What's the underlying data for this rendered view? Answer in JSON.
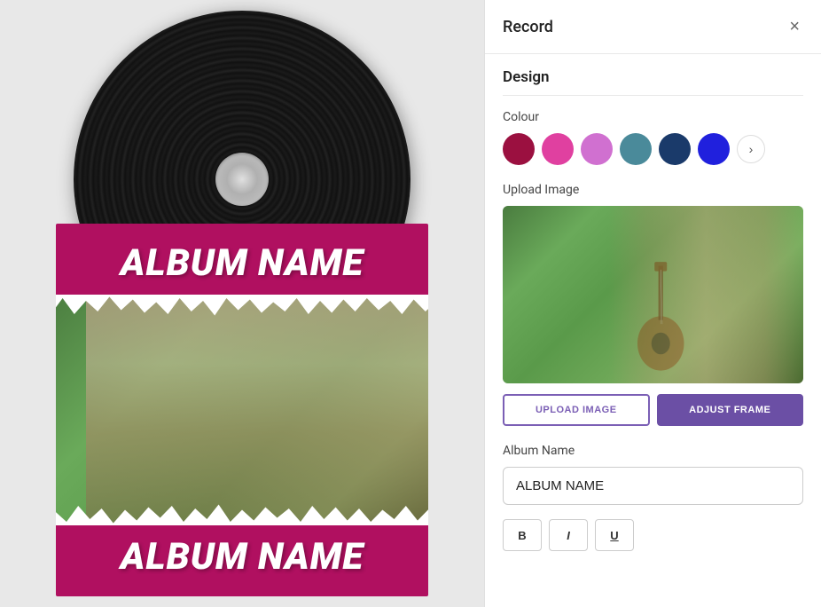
{
  "panel": {
    "title": "Record",
    "close_label": "×"
  },
  "design": {
    "section_title": "Design",
    "colour_label": "Colour",
    "colors": [
      {
        "id": "dark-red",
        "hex": "#9b1040"
      },
      {
        "id": "hot-pink",
        "hex": "#e040a0"
      },
      {
        "id": "lavender",
        "hex": "#d070d0"
      },
      {
        "id": "teal",
        "hex": "#4a8a9a"
      },
      {
        "id": "navy",
        "hex": "#1a3a6a"
      },
      {
        "id": "royal-blue",
        "hex": "#2020dd"
      }
    ],
    "upload_image_label": "Upload Image",
    "upload_button": "UPLOAD IMAGE",
    "adjust_button": "ADJUST FRAME",
    "album_name_label": "Album Name",
    "album_name_value": "ALBUM NAME",
    "album_name_placeholder": "ALBUM NAME"
  },
  "canvas": {
    "album_title_top": "ALBUM NAME",
    "album_title_bottom": "ALBUM NAME"
  },
  "style_buttons": [
    {
      "label": "B",
      "id": "bold"
    },
    {
      "label": "I",
      "id": "italic"
    },
    {
      "label": "U",
      "id": "underline"
    }
  ]
}
